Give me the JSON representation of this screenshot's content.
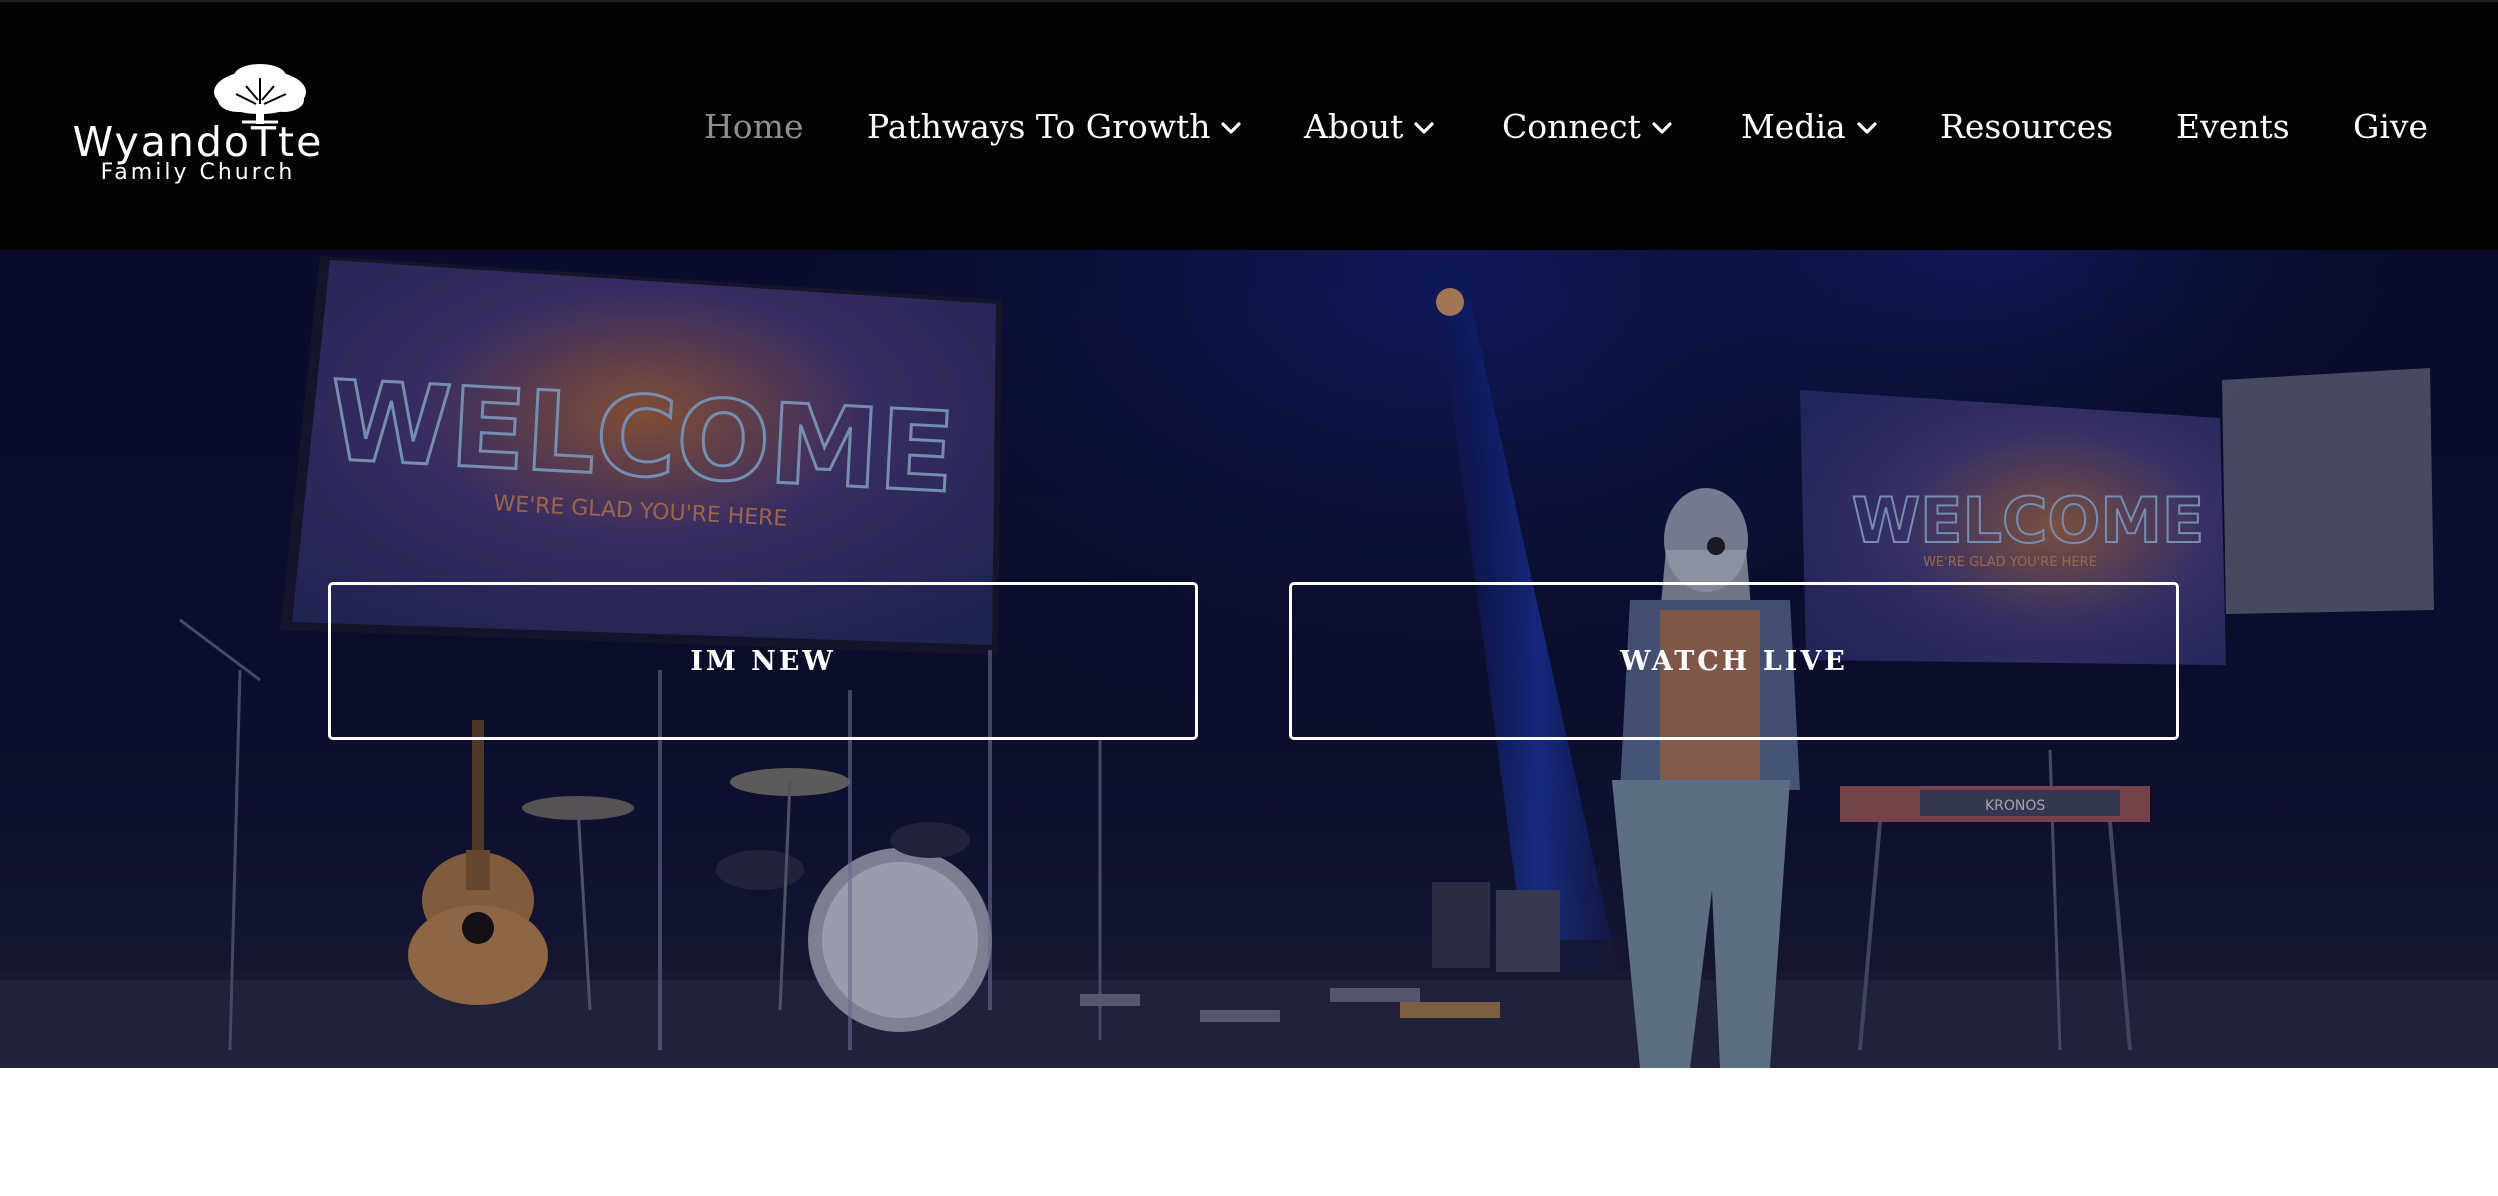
{
  "header": {
    "logo": {
      "line1": "WyandoTte",
      "line2": "Family Church"
    },
    "nav": [
      {
        "label": "Home",
        "active": true,
        "dropdown": false
      },
      {
        "label": "Pathways To Growth",
        "active": false,
        "dropdown": true
      },
      {
        "label": "About",
        "active": false,
        "dropdown": true
      },
      {
        "label": "Connect",
        "active": false,
        "dropdown": true
      },
      {
        "label": "Media",
        "active": false,
        "dropdown": true
      },
      {
        "label": "Resources",
        "active": false,
        "dropdown": false
      },
      {
        "label": "Events",
        "active": false,
        "dropdown": false
      },
      {
        "label": "Give",
        "active": false,
        "dropdown": false
      }
    ]
  },
  "hero": {
    "screen_left": {
      "title": "WELCOME",
      "subtitle": "WE'RE GLAD YOU'RE HERE"
    },
    "screen_right": {
      "title": "WELCOME",
      "subtitle": "WE'RE GLAD YOU'RE HERE"
    },
    "keyboard_label": "KRONOS",
    "buttons": {
      "im_new": "IM NEW",
      "watch_live": "WATCH LIVE"
    }
  },
  "colors": {
    "header_bg": "#030303",
    "nav_text": "#ffffff",
    "nav_active": "#8e8e8e",
    "hero_tint": "#0b0c22"
  }
}
